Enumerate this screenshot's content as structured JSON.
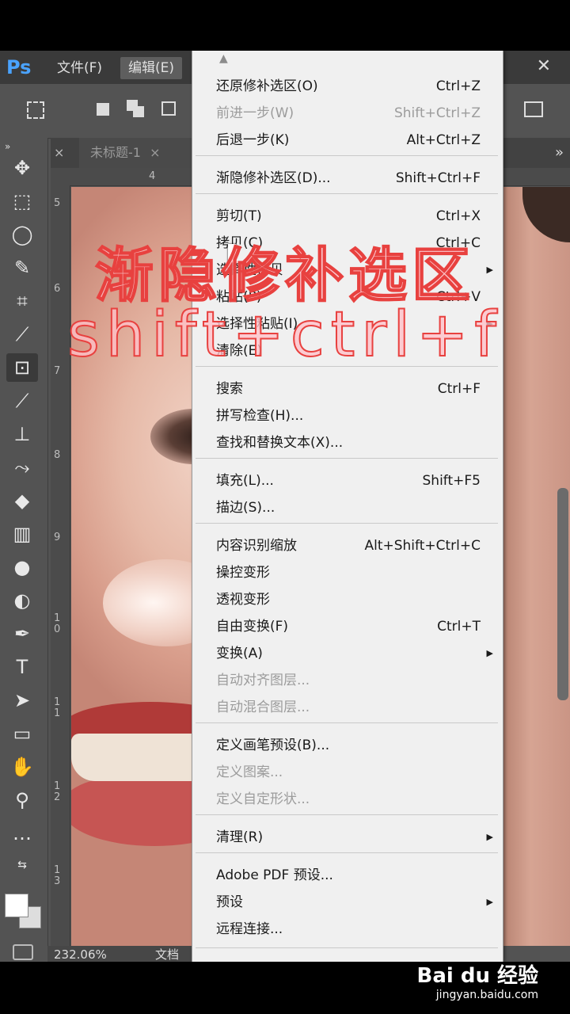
{
  "app": {
    "logo": "Ps"
  },
  "menubar": {
    "file": "文件(F)",
    "edit": "编辑(E)",
    "close": "✕"
  },
  "tab": {
    "close": "×",
    "title": "未标题-1",
    "title_close": "×",
    "more": "»"
  },
  "toolbar_collapse": "»",
  "ruler": {
    "h": [
      "4"
    ],
    "v": [
      "5",
      "6",
      "7",
      "8",
      "9",
      "1\n0",
      "1\n1",
      "1\n2",
      "1\n3"
    ]
  },
  "status": {
    "zoom": "232.06%",
    "doc": "文档"
  },
  "menu": {
    "scroll_up": "▲",
    "items": [
      {
        "label": "还原修补选区(O)",
        "shortcut": "Ctrl+Z",
        "disabled": false
      },
      {
        "label": "前进一步(W)",
        "shortcut": "Shift+Ctrl+Z",
        "disabled": true
      },
      {
        "label": "后退一步(K)",
        "shortcut": "Alt+Ctrl+Z",
        "disabled": false
      },
      {
        "label": "渐隐修补选区(D)...",
        "shortcut": "Shift+Ctrl+F",
        "disabled": false
      },
      {
        "label": "剪切(T)",
        "shortcut": "Ctrl+X",
        "disabled": false
      },
      {
        "label": "拷贝(C)",
        "shortcut": "Ctrl+C",
        "disabled": false
      },
      {
        "label": "选择性拷贝",
        "shortcut": "",
        "disabled": false,
        "submenu": true
      },
      {
        "label": "粘贴(P)",
        "shortcut": "Ctrl+V",
        "disabled": false
      },
      {
        "label": "选择性粘贴(I)",
        "shortcut": "",
        "disabled": false,
        "submenu": true
      },
      {
        "label": "清除(E)",
        "shortcut": "",
        "disabled": false
      },
      {
        "label": "搜索",
        "shortcut": "Ctrl+F",
        "disabled": false
      },
      {
        "label": "拼写检查(H)...",
        "shortcut": "",
        "disabled": false
      },
      {
        "label": "查找和替换文本(X)...",
        "shortcut": "",
        "disabled": false
      },
      {
        "label": "填充(L)...",
        "shortcut": "Shift+F5",
        "disabled": false
      },
      {
        "label": "描边(S)...",
        "shortcut": "",
        "disabled": false
      },
      {
        "label": "内容识别缩放",
        "shortcut": "Alt+Shift+Ctrl+C",
        "disabled": false
      },
      {
        "label": "操控变形",
        "shortcut": "",
        "disabled": false
      },
      {
        "label": "透视变形",
        "shortcut": "",
        "disabled": false
      },
      {
        "label": "自由变换(F)",
        "shortcut": "Ctrl+T",
        "disabled": false
      },
      {
        "label": "变换(A)",
        "shortcut": "",
        "disabled": false,
        "submenu": true
      },
      {
        "label": "自动对齐图层...",
        "shortcut": "",
        "disabled": true
      },
      {
        "label": "自动混合图层...",
        "shortcut": "",
        "disabled": true
      },
      {
        "label": "定义画笔预设(B)...",
        "shortcut": "",
        "disabled": false
      },
      {
        "label": "定义图案...",
        "shortcut": "",
        "disabled": true
      },
      {
        "label": "定义自定形状...",
        "shortcut": "",
        "disabled": true
      },
      {
        "label": "清理(R)",
        "shortcut": "",
        "disabled": false,
        "submenu": true
      },
      {
        "label": "Adobe PDF 预设...",
        "shortcut": "",
        "disabled": false
      },
      {
        "label": "预设",
        "shortcut": "",
        "disabled": false,
        "submenu": true
      },
      {
        "label": "远程连接...",
        "shortcut": "",
        "disabled": false
      }
    ]
  },
  "overlay": {
    "line1": "渐隐修补选区",
    "line2": "shift+ctrl+f"
  },
  "watermark": {
    "logo": "Bai du 经验",
    "url": "jingyan.baidu.com"
  },
  "colors": {
    "menu_bg": "#f0f0f0",
    "app_bg": "#535353",
    "overlay_stroke": "#e8413f",
    "ps_blue": "#4aa3ff"
  }
}
